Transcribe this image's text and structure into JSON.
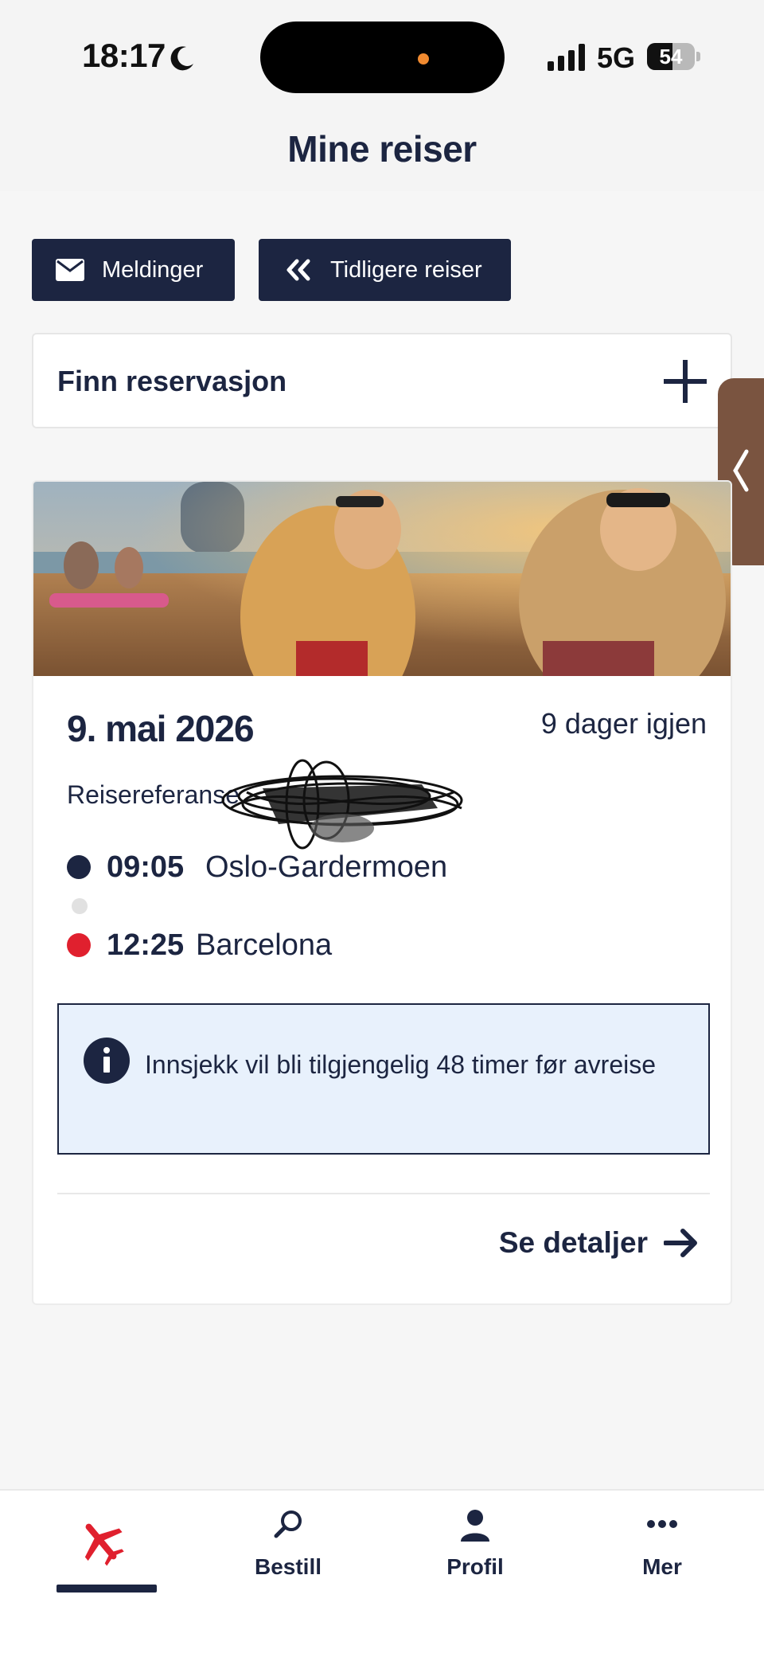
{
  "status_bar": {
    "time": "18:17",
    "network": "5G",
    "battery_percent": 54,
    "battery_label": "54",
    "icons": [
      "moon-icon",
      "signal-icon",
      "battery-icon"
    ]
  },
  "header": {
    "title": "Mine reiser"
  },
  "actions": {
    "messages_label": "Meldinger",
    "previous_trips_label": "Tidligere reiser"
  },
  "find_reservation": {
    "label": "Finn reservasjon"
  },
  "trip": {
    "date": "9. mai 2026",
    "days_left": "9 dager igjen",
    "reference_label": "Reisereferanse",
    "departure": {
      "time": "09:05",
      "place": "Oslo-Gardermoen"
    },
    "arrival": {
      "time": "12:25",
      "place": "Barcelona"
    },
    "info_message": "Innsjekk vil bli tilgjengelig 48 timer før avreise",
    "details_label": "Se detaljer"
  },
  "bottom_nav": {
    "items": [
      {
        "label": "",
        "icon": "airplane-icon",
        "active": true
      },
      {
        "label": "Bestill",
        "icon": "search-icon",
        "active": false
      },
      {
        "label": "Profil",
        "icon": "person-icon",
        "active": false
      },
      {
        "label": "Mer",
        "icon": "more-icon",
        "active": false
      }
    ]
  },
  "colors": {
    "primary": "#1c2541",
    "accent_red": "#e0202e",
    "info_bg": "#e8f1fc",
    "page_bg": "#f6f6f6"
  }
}
